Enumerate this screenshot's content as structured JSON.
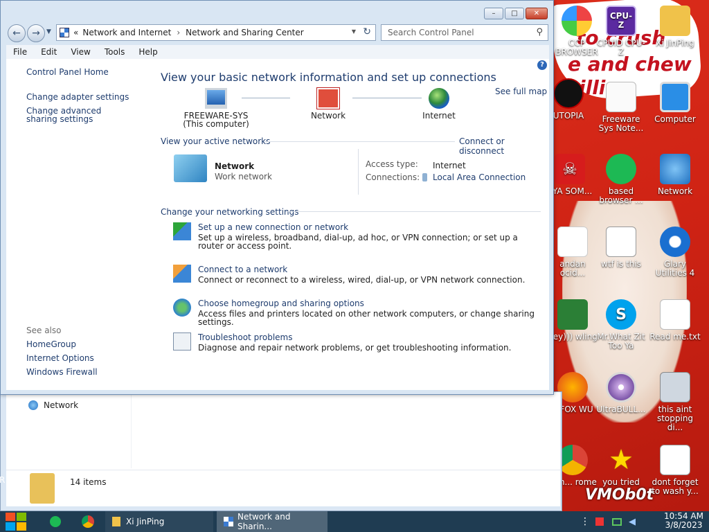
{
  "window": {
    "address_prefix": "«",
    "breadcrumb": [
      "Network and Internet",
      "Network and Sharing Center"
    ],
    "search_placeholder": "Search Control Panel",
    "controls": {
      "minimize": "–",
      "maximize": "□",
      "close": "✕"
    }
  },
  "menu": [
    "File",
    "Edit",
    "View",
    "Tools",
    "Help"
  ],
  "left_nav": {
    "home": "Control Panel Home",
    "links": [
      "Change adapter settings",
      "Change advanced sharing settings"
    ],
    "see_also_title": "See also",
    "see_also": [
      "HomeGroup",
      "Internet Options",
      "Windows Firewall"
    ]
  },
  "main": {
    "title": "View your basic network information and set up connections",
    "see_full_map": "See full map",
    "nodes": [
      {
        "label": "FREEWARE-SYS",
        "sub": "(This computer)"
      },
      {
        "label": "Network",
        "sub": ""
      },
      {
        "label": "Internet",
        "sub": ""
      }
    ],
    "active_networks_title": "View your active networks",
    "connect_disconnect": "Connect or disconnect",
    "active_network": {
      "name": "Network",
      "type": "Work network",
      "access_type_label": "Access type:",
      "access_type": "Internet",
      "connections_label": "Connections:",
      "connection": "Local Area Connection"
    },
    "settings_title": "Change your networking settings",
    "tasks": [
      {
        "link": "Set up a new connection or network",
        "desc": "Set up a wireless, broadband, dial-up, ad hoc, or VPN connection; or set up a router or access point."
      },
      {
        "link": "Connect to a network",
        "desc": "Connect or reconnect to a wireless, wired, dial-up, or VPN network connection."
      },
      {
        "link": "Choose homegroup and sharing options",
        "desc": "Access files and printers located on other network computers, or change sharing settings."
      },
      {
        "link": "Troubleshoot problems",
        "desc": "Diagnose and repair network problems, or get troubleshooting information."
      }
    ]
  },
  "explorer_back": {
    "nav_item": "Network",
    "status": "14 items",
    "left_edge_char": "R"
  },
  "desktop_icons": [
    {
      "label": "CCP BROWSER"
    },
    {
      "label": "CPUID CPU-Z"
    },
    {
      "label": "Xi JinPing"
    },
    {
      "label": "UTOPIA"
    },
    {
      "label": "Freeware Sys Note..."
    },
    {
      "label": "Computer"
    },
    {
      "label": "TYA SOM..."
    },
    {
      "label": "based browser ..."
    },
    {
      "label": "Network"
    },
    {
      "label": "andan ocid..."
    },
    {
      "label": "wtf is this"
    },
    {
      "label": "Glary Utilities 4"
    },
    {
      "label": "ney))) wling"
    },
    {
      "label": "Mr.What Zit Too Ya"
    },
    {
      "label": "Read me.txt"
    },
    {
      "label": "Y FOX WU"
    },
    {
      "label": "UltraBULL..."
    },
    {
      "label": "this aint stopping di..."
    },
    {
      "label": "mm... rome"
    },
    {
      "label": "you tried"
    },
    {
      "label": "dont forget to wash y..."
    }
  ],
  "wallpaper_text": [
    "to crush",
    "e and chew",
    "illin",
    "VMOb0t"
  ],
  "taskbar": {
    "items": [
      "Xi JinPing",
      "Network and Sharin..."
    ],
    "time": "10:54 AM",
    "date": "3/8/2023"
  },
  "colors": {
    "link": "#1e3c6e",
    "taskbar": "#1f3c52",
    "desktop": "#d82a1c"
  }
}
